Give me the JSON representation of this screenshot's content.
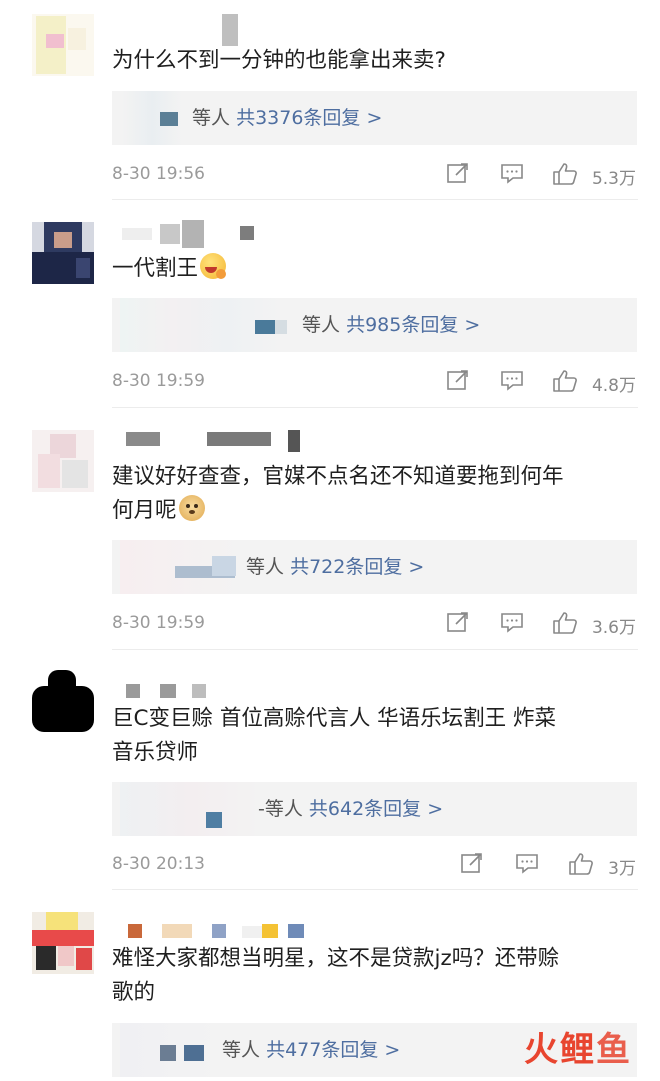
{
  "comments": [
    {
      "text": "为什么不到一分钟的也能拿出来卖?",
      "reply_prefix": "等人",
      "reply_count": "共3376条回复 >",
      "time": "8-30 19:56",
      "likes": "5.3万"
    },
    {
      "text": "一代割王",
      "reply_prefix": "等人",
      "reply_count": "共985条回复 >",
      "time": "8-30 19:59",
      "likes": "4.8万"
    },
    {
      "text_line1": "建议好好查查，官媒不点名还不知道要拖到何年",
      "text_line2": "何月呢",
      "reply_prefix": "等人",
      "reply_count": "共722条回复 >",
      "time": "8-30 19:59",
      "likes": "3.6万"
    },
    {
      "text_line1": "巨C变巨赊 首位高赊代言人 华语乐坛割王 炸菜",
      "text_line2": "音乐贷师",
      "reply_prefix": "-等人",
      "reply_count": "共642条回复 >",
      "time": "8-30 20:13",
      "likes": "3万"
    },
    {
      "text_line1": "难怪大家都想当明星，这不是贷款jz吗？还带赊",
      "text_line2": "歌的",
      "reply_prefix": "等人",
      "reply_count": "共477条回复 >"
    }
  ],
  "icons": {
    "share": "share-icon",
    "comment": "comment-icon",
    "like": "thumbs-up-icon"
  },
  "watermark": "火鲤鱼",
  "colors": {
    "link_blue": "#4e6ea0",
    "reply_bg": "#f3f3f3",
    "meta_gray": "#9a9a9a"
  }
}
